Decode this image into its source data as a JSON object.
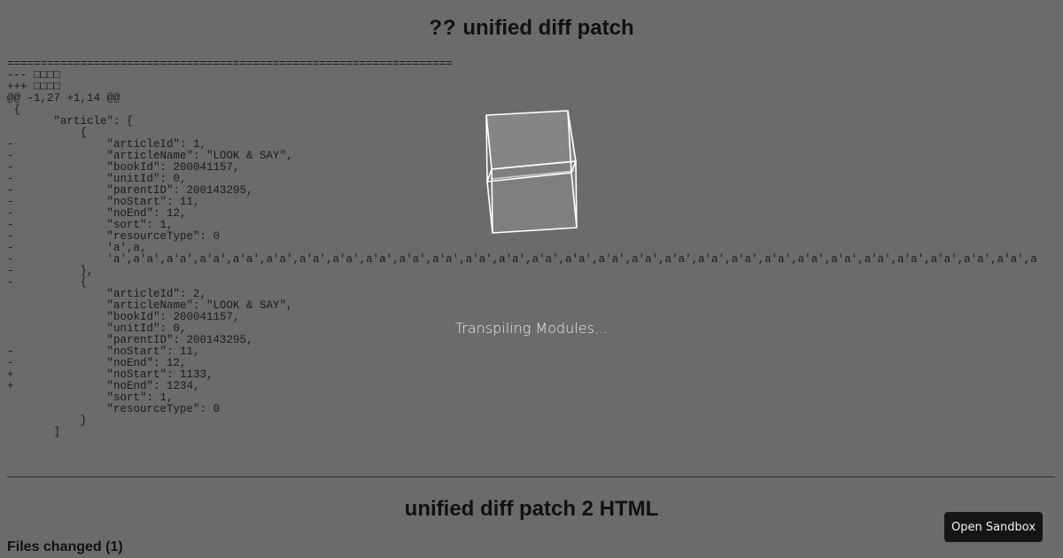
{
  "page": {
    "title_prefix_glyphs": "??",
    "title_text": " unified diff patch",
    "subtitle": "unified diff patch 2 HTML",
    "files_changed": "Files changed (1)"
  },
  "diff": {
    "lines": [
      "===================================================================",
      "--- □□□□",
      "+++ □□□□",
      "@@ -1,27 +1,14 @@",
      " {",
      "       \"article\": [",
      "           {",
      "-              \"articleId\": 1,",
      "-              \"articleName\": \"LOOK & SAY\",",
      "-              \"bookId\": 200041157,",
      "-              \"unitId\": 0,",
      "-              \"parentID\": 200143295,",
      "-              \"noStart\": 11,",
      "-              \"noEnd\": 12,",
      "-              \"sort\": 1,",
      "-              \"resourceType\": 0",
      "-              'a',a,",
      "-              'a',a'a',a'a',a'a',a'a',a'a',a'a',a'a',a'a',a'a',a'a',a'a',a'a',a'a',a'a',a'a',a'a',a'a',a'a',a'a',a'a',a'a',a'a',a'a',a'a',a'a',a'a',a'a',a",
      "-          },",
      "-          {",
      "               \"articleId\": 2,",
      "               \"articleName\": \"LOOK & SAY\",",
      "               \"bookId\": 200041157,",
      "               \"unitId\": 0,",
      "               \"parentID\": 200143295,",
      "-              \"noStart\": 11,",
      "-              \"noEnd\": 12,",
      "+              \"noStart\": 1133,",
      "+              \"noEnd\": 1234,",
      "               \"sort\": 1,",
      "               \"resourceType\": 0",
      "           }",
      "       ]"
    ]
  },
  "overlay": {
    "status": "Transpiling Modules...",
    "loader_icon": "cube-loader"
  },
  "buttons": {
    "open_sandbox": "Open Sandbox"
  },
  "colors": {
    "background": "#6b6b6b",
    "button_bg": "#151515",
    "overlay_text": "#eaeaea"
  }
}
